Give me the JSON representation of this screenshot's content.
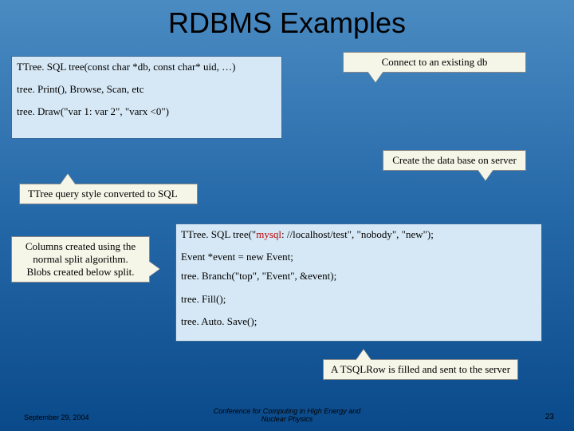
{
  "title": "RDBMS Examples",
  "box1": {
    "l1": "TTree. SQL tree(const char *db, const char* uid, …)",
    "l2": "tree. Print(), Browse, Scan, etc",
    "l3": "tree. Draw(\"var 1: var 2\", \"varx <0\")"
  },
  "box2": {
    "l1a": "TTree. SQL tree(\"",
    "l1b": "mysql",
    "l1c": ": //localhost/test\", \"nobody\", \"new\");",
    "l2": "Event *event = new Event;",
    "l3": "tree. Branch(\"top\", \"Event\", &event);",
    "l4": "tree. Fill();",
    "l5": "tree. Auto. Save();"
  },
  "callouts": {
    "c1": "Connect to an existing db",
    "c2": "Create the data base on server",
    "c3": "TTree query style converted to SQL",
    "c4": "Columns created using the normal split algorithm.\nBlobs created below split.",
    "c5": "A TSQLRow is filled and sent to the server"
  },
  "footer": {
    "date": "September 29, 2004",
    "center": "Conference for Computing in High Energy and Nuclear Physics",
    "num": "23"
  }
}
